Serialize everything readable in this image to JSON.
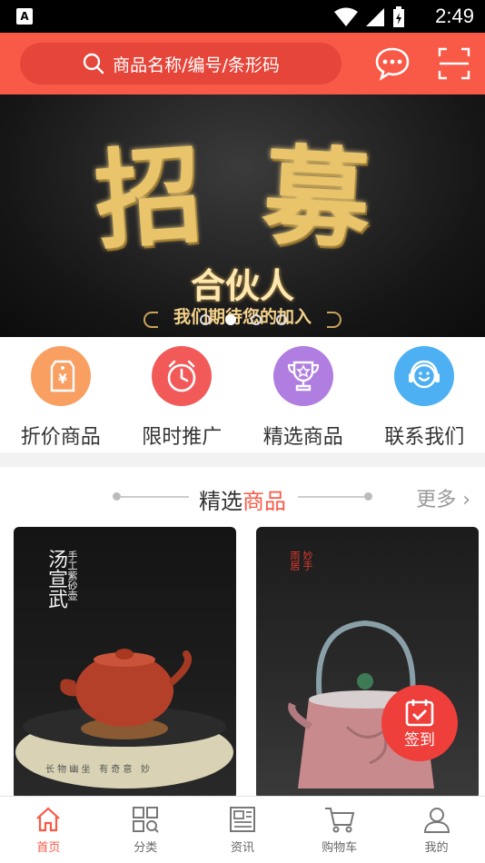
{
  "status_bar": {
    "time": "2:49",
    "app_icon": "A"
  },
  "search": {
    "placeholder": "商品名称/编号/条形码"
  },
  "header_icons": {
    "message": "chat-bubble-icon",
    "scan": "scan-frame-icon"
  },
  "banner": {
    "headline_1": "招",
    "headline_2": "募",
    "subtitle": "合伙人",
    "slogan": "我们期待您的加入",
    "slide_count": 4,
    "active_slide": 2
  },
  "quick_links": [
    {
      "label": "折价商品",
      "icon": "price-tag-icon",
      "color": "#f99f62"
    },
    {
      "label": "限时推广",
      "icon": "alarm-clock-icon",
      "color": "#f25a5a"
    },
    {
      "label": "精选商品",
      "icon": "trophy-star-icon",
      "color": "#b07de0"
    },
    {
      "label": "联系我们",
      "icon": "headset-icon",
      "color": "#4db0f3"
    }
  ],
  "featured": {
    "title_plain": "精选",
    "title_accent": "商品",
    "more_label": "更多"
  },
  "products": [
    {
      "text_main": "汤宣武",
      "text_side": "手工紫砂壶"
    },
    {
      "text_main": "妙手",
      "text_side": "雨居"
    }
  ],
  "signin_label": "签到",
  "tabs": [
    {
      "label": "首页",
      "icon": "home-icon",
      "active": true
    },
    {
      "label": "分类",
      "icon": "category-grid-icon",
      "active": false
    },
    {
      "label": "资讯",
      "icon": "news-icon",
      "active": false
    },
    {
      "label": "购物车",
      "icon": "cart-icon",
      "active": false
    },
    {
      "label": "我的",
      "icon": "user-icon",
      "active": false
    }
  ],
  "colors": {
    "brand": "#f95a48",
    "signin": "#ef3f3b"
  }
}
